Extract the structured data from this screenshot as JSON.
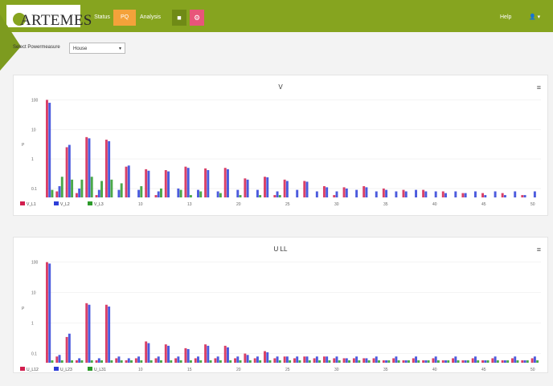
{
  "app": {
    "logo": "ARTEMES",
    "nav": [
      "Status",
      "PQ",
      "Analysis"
    ],
    "active_nav": "PQ",
    "right": {
      "help": "Help"
    }
  },
  "selector": {
    "label": "Select Powermeasure",
    "value": "House"
  },
  "chart_data": [
    {
      "type": "bar",
      "title": "V",
      "ylabel": "P",
      "y_tick_labels": [
        "100",
        "10",
        "1",
        "0.1"
      ],
      "x_tick_labels": [
        "10",
        "13",
        "20",
        "25",
        "30",
        "35",
        "40",
        "45",
        "50"
      ],
      "legend": [
        "V_L1",
        "V_L2",
        "V_L3"
      ],
      "series_colors": [
        "#d21e4e",
        "#2d3ed8",
        "#2c9a2a"
      ],
      "series": [
        {
          "name": "V_L1",
          "values": [
            100,
            0.08,
            2.5,
            0.07,
            5.5,
            0.06,
            4.5,
            0.05,
            0.55,
            0.05,
            0.45,
            0.06,
            0.42,
            0.05,
            0.55,
            0.05,
            0.48,
            0.05,
            0.5,
            0.05,
            0.22,
            0.05,
            0.25,
            0.06,
            0.2,
            0.05,
            0.18,
            0.05,
            0.12,
            0.06,
            0.11,
            0.05,
            0.12,
            0.05,
            0.1,
            0.05,
            0.09,
            0.05,
            0.09,
            0.05,
            0.08,
            0.05,
            0.07,
            0.05,
            0.07,
            0.05,
            0.07,
            0.05,
            0.06,
            0.05
          ]
        },
        {
          "name": "V_L2",
          "values": [
            80,
            0.12,
            3.0,
            0.1,
            5.0,
            0.09,
            4.0,
            0.09,
            0.6,
            0.09,
            0.4,
            0.08,
            0.38,
            0.1,
            0.5,
            0.09,
            0.42,
            0.08,
            0.45,
            0.09,
            0.2,
            0.09,
            0.24,
            0.08,
            0.18,
            0.09,
            0.17,
            0.08,
            0.11,
            0.08,
            0.1,
            0.09,
            0.11,
            0.08,
            0.09,
            0.08,
            0.08,
            0.09,
            0.08,
            0.08,
            0.07,
            0.08,
            0.07,
            0.08,
            0.06,
            0.08,
            0.06,
            0.08,
            0.06,
            0.08
          ]
        },
        {
          "name": "V_L3",
          "values": [
            0.09,
            0.25,
            0.2,
            0.2,
            0.25,
            0.18,
            0.2,
            0.15,
            0.05,
            0.12,
            0.05,
            0.1,
            0.05,
            0.09,
            0.06,
            0.08,
            0.05,
            0.07,
            0.05,
            0.06,
            0.05,
            0.06,
            0.05,
            0.06,
            0.05,
            0.05,
            0.05,
            0.05,
            0.05,
            0.05,
            0.05,
            0.05,
            0.05,
            0.05,
            0.05,
            0.05,
            0.05,
            0.05,
            0.05,
            0.05,
            0.05,
            0.05,
            0.05,
            0.05,
            0.05,
            0.05,
            0.05,
            0.05,
            0.05,
            0.05
          ]
        }
      ]
    },
    {
      "type": "bar",
      "title": "U LL",
      "ylabel": "P",
      "y_tick_labels": [
        "100",
        "10",
        "1",
        "0.1"
      ],
      "x_tick_labels": [
        "10",
        "15",
        "20",
        "25",
        "30",
        "35",
        "40",
        "45",
        "50"
      ],
      "legend": [
        "U_L12",
        "U_L23",
        "U_L31"
      ],
      "series_colors": [
        "#d21e4e",
        "#2d3ed8",
        "#2c9a2a"
      ],
      "series": [
        {
          "name": "U_L12",
          "values": [
            100,
            0.08,
            0.35,
            0.06,
            4.5,
            0.06,
            4.0,
            0.07,
            0.06,
            0.07,
            0.25,
            0.07,
            0.2,
            0.07,
            0.15,
            0.07,
            0.2,
            0.07,
            0.18,
            0.07,
            0.1,
            0.07,
            0.12,
            0.07,
            0.08,
            0.07,
            0.08,
            0.07,
            0.08,
            0.07,
            0.07,
            0.07,
            0.07,
            0.07,
            0.06,
            0.07,
            0.06,
            0.07,
            0.06,
            0.07,
            0.06,
            0.07,
            0.06,
            0.07,
            0.06,
            0.07,
            0.06,
            0.07,
            0.06,
            0.07
          ]
        },
        {
          "name": "U_L23",
          "values": [
            90,
            0.09,
            0.45,
            0.07,
            4.0,
            0.07,
            3.5,
            0.08,
            0.07,
            0.08,
            0.22,
            0.08,
            0.18,
            0.08,
            0.14,
            0.08,
            0.18,
            0.08,
            0.16,
            0.08,
            0.09,
            0.08,
            0.11,
            0.08,
            0.08,
            0.08,
            0.08,
            0.08,
            0.08,
            0.08,
            0.07,
            0.08,
            0.07,
            0.08,
            0.06,
            0.08,
            0.06,
            0.08,
            0.06,
            0.08,
            0.06,
            0.08,
            0.06,
            0.08,
            0.06,
            0.08,
            0.06,
            0.08,
            0.06,
            0.08
          ]
        },
        {
          "name": "U_L31",
          "values": [
            0.06,
            0.06,
            0.06,
            0.06,
            0.06,
            0.06,
            0.06,
            0.06,
            0.06,
            0.06,
            0.06,
            0.06,
            0.06,
            0.06,
            0.06,
            0.06,
            0.06,
            0.06,
            0.06,
            0.06,
            0.06,
            0.06,
            0.06,
            0.06,
            0.06,
            0.06,
            0.06,
            0.06,
            0.06,
            0.06,
            0.06,
            0.06,
            0.06,
            0.06,
            0.06,
            0.06,
            0.06,
            0.06,
            0.06,
            0.06,
            0.06,
            0.06,
            0.06,
            0.06,
            0.06,
            0.06,
            0.06,
            0.06,
            0.06,
            0.06
          ]
        }
      ]
    }
  ]
}
